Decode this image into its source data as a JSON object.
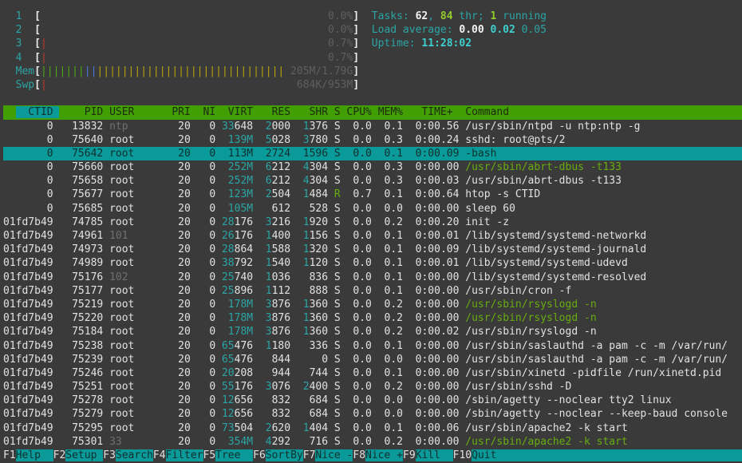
{
  "colors": {
    "background": "#3a3a3a",
    "header_green": "#419e03",
    "accent_cyan": "#0b9a9a",
    "text_cyan": "#2ba5a5",
    "text_green": "#68ad10",
    "text_white": "#e2e2e2",
    "text_gray": "#6f6f6f",
    "bar_red": "#c0392b",
    "bar_green": "#4ea818",
    "bar_blue": "#4a79d8",
    "bar_yellow": "#b5a30a"
  },
  "meters": {
    "cpus": [
      {
        "label": "1",
        "percent": "0.0%",
        "bars": []
      },
      {
        "label": "2",
        "percent": "0.0%",
        "bars": []
      },
      {
        "label": "3",
        "percent": "0.7%",
        "bars": [
          [
            "bar-red",
            1
          ]
        ]
      },
      {
        "label": "4",
        "percent": "0.7%",
        "bars": [
          [
            "bar-red",
            1
          ]
        ]
      }
    ],
    "mem": {
      "label": "Mem",
      "value": "205M/1.79G",
      "bars": [
        [
          "bar-green",
          7
        ],
        [
          "bar-blue",
          2
        ],
        [
          "bar-yellow",
          30
        ]
      ]
    },
    "swp": {
      "label": "Swp",
      "value": "684K/953M",
      "bars": [
        [
          "bar-red",
          1
        ]
      ]
    }
  },
  "info": {
    "tasks": [
      [
        "Tasks: ",
        "c"
      ],
      [
        "62",
        "wb"
      ],
      [
        ", ",
        "c"
      ],
      [
        "84",
        "gb"
      ],
      [
        " thr; ",
        "c"
      ],
      [
        "1",
        "gb"
      ],
      [
        " running",
        "c"
      ]
    ],
    "load": [
      [
        "Load average: ",
        "c"
      ],
      [
        "0.00 ",
        "wb"
      ],
      [
        "0.02 ",
        "cb"
      ],
      [
        "0.05",
        "c"
      ]
    ],
    "uptime": [
      [
        "Uptime: ",
        "c"
      ],
      [
        "11:28:02",
        "cb"
      ]
    ]
  },
  "table": {
    "sort_column": "CTID",
    "columns": {
      "ctid": "CTID",
      "pid": "PID",
      "user": "USER",
      "pri": "PRI",
      "ni": "NI",
      "virt": "VIRT",
      "res": "RES",
      "shr": "SHR",
      "s": "S",
      "cpu": "CPU%",
      "mem": "MEM%",
      "time": "  TIME+ ",
      "cmd": "Command"
    },
    "rows": [
      {
        "ctid": "0",
        "pid": "13832",
        "user": "ntp",
        "user_dim": true,
        "pri": "20",
        "ni": "0",
        "virt": "33648",
        "res": "2000",
        "shr": "1376",
        "s": "S",
        "cpu": "0.0",
        "mem": "0.1",
        "time": "0:00.56",
        "cmd": "/usr/sbin/ntpd -u ntp:ntp -g"
      },
      {
        "ctid": "0",
        "pid": "75640",
        "user": "root",
        "pri": "20",
        "ni": "0",
        "virt": "139M",
        "res": "5028",
        "shr": "3780",
        "s": "S",
        "cpu": "0.0",
        "mem": "0.3",
        "time": "0:00.24",
        "cmd": "sshd: root@pts/2"
      },
      {
        "ctid": "0",
        "pid": "75642",
        "user": "root",
        "pri": "20",
        "ni": "0",
        "virt": "113M",
        "res": "2724",
        "shr": "1596",
        "s": "S",
        "cpu": "0.0",
        "mem": "0.1",
        "time": "0:00.09",
        "cmd": "-bash",
        "selected": true
      },
      {
        "ctid": "0",
        "pid": "75660",
        "user": "root",
        "pri": "20",
        "ni": "0",
        "virt": "252M",
        "res": "6212",
        "shr": "4304",
        "s": "S",
        "cpu": "0.0",
        "mem": "0.3",
        "time": "0:00.00",
        "cmd": "/usr/sbin/abrt-dbus -t133",
        "cmd_green": true
      },
      {
        "ctid": "0",
        "pid": "75658",
        "user": "root",
        "pri": "20",
        "ni": "0",
        "virt": "252M",
        "res": "6212",
        "shr": "4304",
        "s": "S",
        "cpu": "0.0",
        "mem": "0.3",
        "time": "0:00.03",
        "cmd": "/usr/sbin/abrt-dbus -t133"
      },
      {
        "ctid": "0",
        "pid": "75677",
        "user": "root",
        "pri": "20",
        "ni": "0",
        "virt": "123M",
        "res": "2504",
        "shr": "1484",
        "s": "R",
        "cpu": "0.7",
        "mem": "0.1",
        "time": "0:00.64",
        "cmd": "htop -s CTID"
      },
      {
        "ctid": "0",
        "pid": "75685",
        "user": "root",
        "pri": "20",
        "ni": "0",
        "virt": "105M",
        "res": "612",
        "shr": "528",
        "s": "S",
        "cpu": "0.0",
        "mem": "0.0",
        "time": "0:00.00",
        "cmd": "sleep 60"
      },
      {
        "ctid": "01fd7b49",
        "pid": "74785",
        "user": "root",
        "pri": "20",
        "ni": "0",
        "virt": "28176",
        "res": "3216",
        "shr": "1920",
        "s": "S",
        "cpu": "0.0",
        "mem": "0.2",
        "time": "0:00.20",
        "cmd": "init -z"
      },
      {
        "ctid": "01fd7b49",
        "pid": "74961",
        "user": "101",
        "user_dim": true,
        "pri": "20",
        "ni": "0",
        "virt": "26176",
        "res": "1400",
        "shr": "1156",
        "s": "S",
        "cpu": "0.0",
        "mem": "0.1",
        "time": "0:00.01",
        "cmd": "/lib/systemd/systemd-networkd"
      },
      {
        "ctid": "01fd7b49",
        "pid": "74973",
        "user": "root",
        "pri": "20",
        "ni": "0",
        "virt": "28864",
        "res": "1588",
        "shr": "1320",
        "s": "S",
        "cpu": "0.0",
        "mem": "0.1",
        "time": "0:00.09",
        "cmd": "/lib/systemd/systemd-journald"
      },
      {
        "ctid": "01fd7b49",
        "pid": "74989",
        "user": "root",
        "pri": "20",
        "ni": "0",
        "virt": "38792",
        "res": "1540",
        "shr": "1120",
        "s": "S",
        "cpu": "0.0",
        "mem": "0.1",
        "time": "0:00.01",
        "cmd": "/lib/systemd/systemd-udevd"
      },
      {
        "ctid": "01fd7b49",
        "pid": "75176",
        "user": "102",
        "user_dim": true,
        "pri": "20",
        "ni": "0",
        "virt": "25740",
        "res": "1036",
        "shr": "836",
        "s": "S",
        "cpu": "0.0",
        "mem": "0.1",
        "time": "0:00.00",
        "cmd": "/lib/systemd/systemd-resolved"
      },
      {
        "ctid": "01fd7b49",
        "pid": "75177",
        "user": "root",
        "pri": "20",
        "ni": "0",
        "virt": "25896",
        "res": "1112",
        "shr": "888",
        "s": "S",
        "cpu": "0.0",
        "mem": "0.1",
        "time": "0:00.00",
        "cmd": "/usr/sbin/cron -f"
      },
      {
        "ctid": "01fd7b49",
        "pid": "75219",
        "user": "root",
        "pri": "20",
        "ni": "0",
        "virt": "178M",
        "res": "3876",
        "shr": "1360",
        "s": "S",
        "cpu": "0.0",
        "mem": "0.2",
        "time": "0:00.00",
        "cmd": "/usr/sbin/rsyslogd -n",
        "cmd_green": true
      },
      {
        "ctid": "01fd7b49",
        "pid": "75220",
        "user": "root",
        "pri": "20",
        "ni": "0",
        "virt": "178M",
        "res": "3876",
        "shr": "1360",
        "s": "S",
        "cpu": "0.0",
        "mem": "0.2",
        "time": "0:00.00",
        "cmd": "/usr/sbin/rsyslogd -n",
        "cmd_green": true
      },
      {
        "ctid": "01fd7b49",
        "pid": "75184",
        "user": "root",
        "pri": "20",
        "ni": "0",
        "virt": "178M",
        "res": "3876",
        "shr": "1360",
        "s": "S",
        "cpu": "0.0",
        "mem": "0.2",
        "time": "0:00.02",
        "cmd": "/usr/sbin/rsyslogd -n"
      },
      {
        "ctid": "01fd7b49",
        "pid": "75238",
        "user": "root",
        "pri": "20",
        "ni": "0",
        "virt": "65476",
        "res": "1180",
        "shr": "336",
        "s": "S",
        "cpu": "0.0",
        "mem": "0.1",
        "time": "0:00.00",
        "cmd": "/usr/sbin/saslauthd -a pam -c -m /var/run/"
      },
      {
        "ctid": "01fd7b49",
        "pid": "75239",
        "user": "root",
        "pri": "20",
        "ni": "0",
        "virt": "65476",
        "res": "844",
        "shr": "0",
        "s": "S",
        "cpu": "0.0",
        "mem": "0.0",
        "time": "0:00.00",
        "cmd": "/usr/sbin/saslauthd -a pam -c -m /var/run/"
      },
      {
        "ctid": "01fd7b49",
        "pid": "75246",
        "user": "root",
        "pri": "20",
        "ni": "0",
        "virt": "20208",
        "res": "944",
        "shr": "744",
        "s": "S",
        "cpu": "0.0",
        "mem": "0.1",
        "time": "0:00.00",
        "cmd": "/usr/sbin/xinetd -pidfile /run/xinetd.pid"
      },
      {
        "ctid": "01fd7b49",
        "pid": "75251",
        "user": "root",
        "pri": "20",
        "ni": "0",
        "virt": "55176",
        "res": "3076",
        "shr": "2400",
        "s": "S",
        "cpu": "0.0",
        "mem": "0.2",
        "time": "0:00.00",
        "cmd": "/usr/sbin/sshd -D"
      },
      {
        "ctid": "01fd7b49",
        "pid": "75278",
        "user": "root",
        "pri": "20",
        "ni": "0",
        "virt": "12656",
        "res": "832",
        "shr": "684",
        "s": "S",
        "cpu": "0.0",
        "mem": "0.0",
        "time": "0:00.00",
        "cmd": "/sbin/agetty --noclear tty2 linux"
      },
      {
        "ctid": "01fd7b49",
        "pid": "75279",
        "user": "root",
        "pri": "20",
        "ni": "0",
        "virt": "12656",
        "res": "832",
        "shr": "684",
        "s": "S",
        "cpu": "0.0",
        "mem": "0.0",
        "time": "0:00.00",
        "cmd": "/sbin/agetty --noclear --keep-baud console"
      },
      {
        "ctid": "01fd7b49",
        "pid": "75295",
        "user": "root",
        "pri": "20",
        "ni": "0",
        "virt": "73504",
        "res": "2620",
        "shr": "1404",
        "s": "S",
        "cpu": "0.0",
        "mem": "0.1",
        "time": "0:00.06",
        "cmd": "/usr/sbin/apache2 -k start"
      },
      {
        "ctid": "01fd7b49",
        "pid": "75301",
        "user": "33",
        "user_dim": true,
        "pri": "20",
        "ni": "0",
        "virt": "354M",
        "res": "4292",
        "shr": "716",
        "s": "S",
        "cpu": "0.0",
        "mem": "0.2",
        "time": "0:00.00",
        "cmd": "/usr/sbin/apache2 -k start",
        "cmd_green": true
      }
    ]
  },
  "fkeys": [
    {
      "key": "F1",
      "label": "Help"
    },
    {
      "key": "F2",
      "label": "Setup"
    },
    {
      "key": "F3",
      "label": "Search"
    },
    {
      "key": "F4",
      "label": "Filter"
    },
    {
      "key": "F5",
      "label": "Tree"
    },
    {
      "key": "F6",
      "label": "SortBy"
    },
    {
      "key": "F7",
      "label": "Nice -"
    },
    {
      "key": "F8",
      "label": "Nice +"
    },
    {
      "key": "F9",
      "label": "Kill"
    },
    {
      "key": "F10",
      "label": "Quit"
    }
  ]
}
